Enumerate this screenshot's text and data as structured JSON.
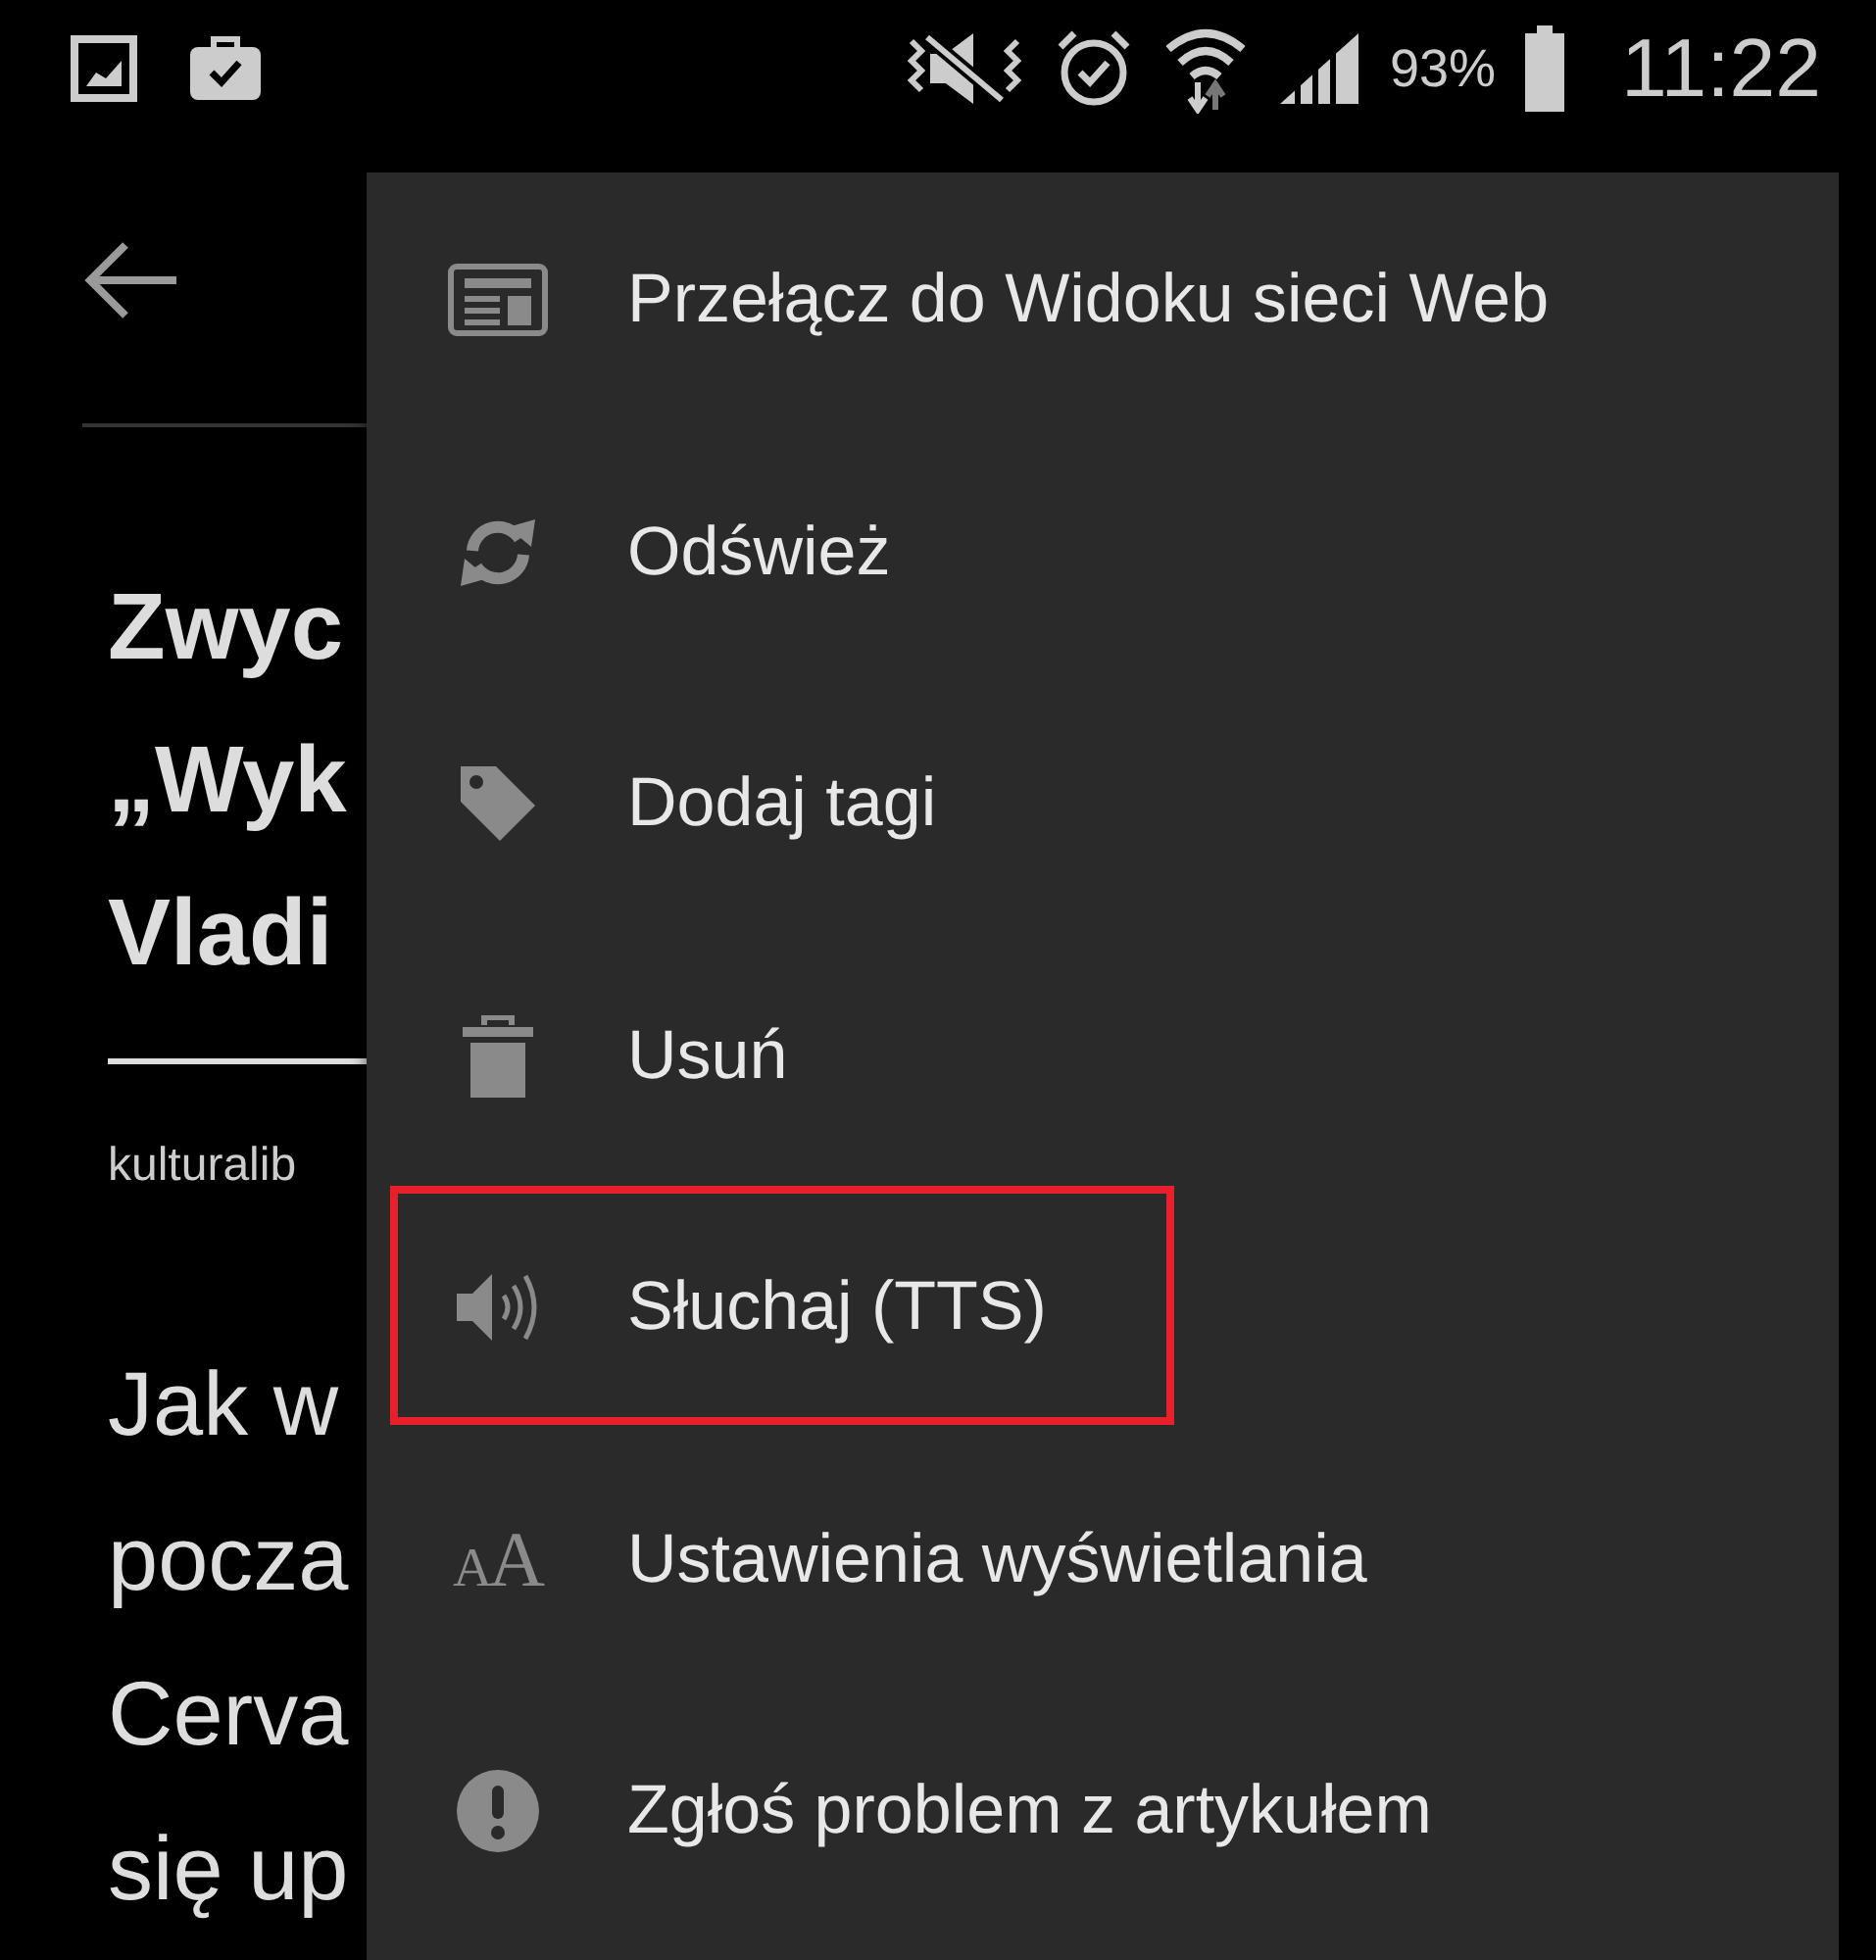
{
  "status_bar": {
    "battery_percent": "93%",
    "time": "11:22"
  },
  "article": {
    "title_lines": [
      "Zwyc",
      "„Wyk",
      "Vladi"
    ],
    "source": "kulturalib",
    "body_lines": [
      "Jak w",
      "pocza",
      "Cerva",
      "się up"
    ]
  },
  "menu": {
    "items": [
      {
        "kind": "web-view",
        "label": "Przełącz do Widoku sieci Web",
        "highlighted": false
      },
      {
        "kind": "refresh",
        "label": "Odśwież",
        "highlighted": false
      },
      {
        "kind": "tag",
        "label": "Dodaj tagi",
        "highlighted": false
      },
      {
        "kind": "trash",
        "label": "Usuń",
        "highlighted": false
      },
      {
        "kind": "speaker",
        "label": "Słuchaj (TTS)",
        "highlighted": true
      },
      {
        "kind": "glyph",
        "glyph": "AA",
        "label": "Ustawienia wyświetlania",
        "highlighted": false
      },
      {
        "kind": "alert",
        "label": "Zgłoś problem z artykułem",
        "highlighted": false
      }
    ]
  }
}
